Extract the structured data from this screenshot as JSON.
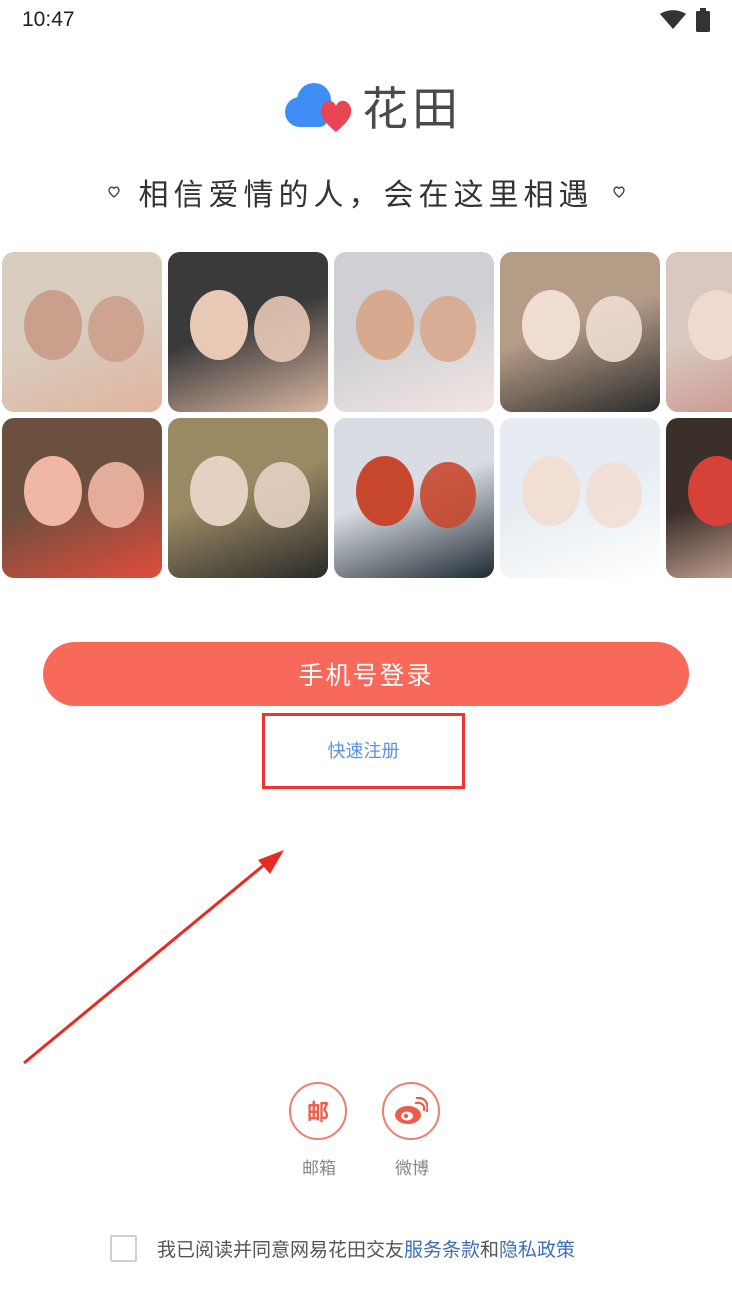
{
  "status_bar": {
    "time": "10:47",
    "icons": [
      "wifi-icon",
      "battery-icon"
    ]
  },
  "logo": {
    "brand_name": "花田",
    "icon": "heart-cloud-logo-icon",
    "colors": {
      "blue": "#3f8ef5",
      "red": "#e94452"
    }
  },
  "tagline": {
    "text": "相信爱情的人，会在这里相遇",
    "decoration": "heart-icon"
  },
  "photos": [
    {
      "desc": "couple-photo",
      "palette": [
        "#d9cdbf",
        "#caa08c",
        "#e0b49f"
      ]
    },
    {
      "desc": "couple-photo",
      "palette": [
        "#3a3a3a",
        "#e8c9b6",
        "#dbb7a2"
      ]
    },
    {
      "desc": "couple-photo",
      "palette": [
        "#cfcfd4",
        "#d7a98e",
        "#f2e6e2"
      ]
    },
    {
      "desc": "couple-photo",
      "palette": [
        "#b49c87",
        "#f0ddd2",
        "#2b2b2b"
      ]
    },
    {
      "desc": "couple-photo",
      "palette": [
        "#d8c8c0",
        "#f0d9cf",
        "#c98a84"
      ]
    },
    {
      "desc": "couple-photo",
      "palette": [
        "#6b4f3f",
        "#f0b7a4",
        "#e24c3b"
      ]
    },
    {
      "desc": "couple-photo",
      "palette": [
        "#9a8a63",
        "#e5d1c2",
        "#2a2a2a"
      ]
    },
    {
      "desc": "couple-photo",
      "palette": [
        "#d9dde3",
        "#c8482f",
        "#1f2a33"
      ]
    },
    {
      "desc": "couple-photo",
      "palette": [
        "#e6ecf1",
        "#f1dfd5",
        "#ffffff"
      ]
    },
    {
      "desc": "couple-photo",
      "palette": [
        "#3b2f2a",
        "#d6413a",
        "#f0c7b4"
      ]
    }
  ],
  "login_button": {
    "label": "手机号登录",
    "color": "#f9695a"
  },
  "register": {
    "label": "快速注册",
    "highlight_color": "#e33333"
  },
  "social_login": [
    {
      "label": "邮箱",
      "glyph": "邮",
      "icon": "mail-icon"
    },
    {
      "label": "微博",
      "glyph": "",
      "icon": "weibo-icon"
    }
  ],
  "agreement": {
    "prefix": "我已阅读并同意网易花田交友",
    "terms_link": "服务条款",
    "conjunction": "和",
    "privacy_link": "隐私政策",
    "checked": false
  }
}
